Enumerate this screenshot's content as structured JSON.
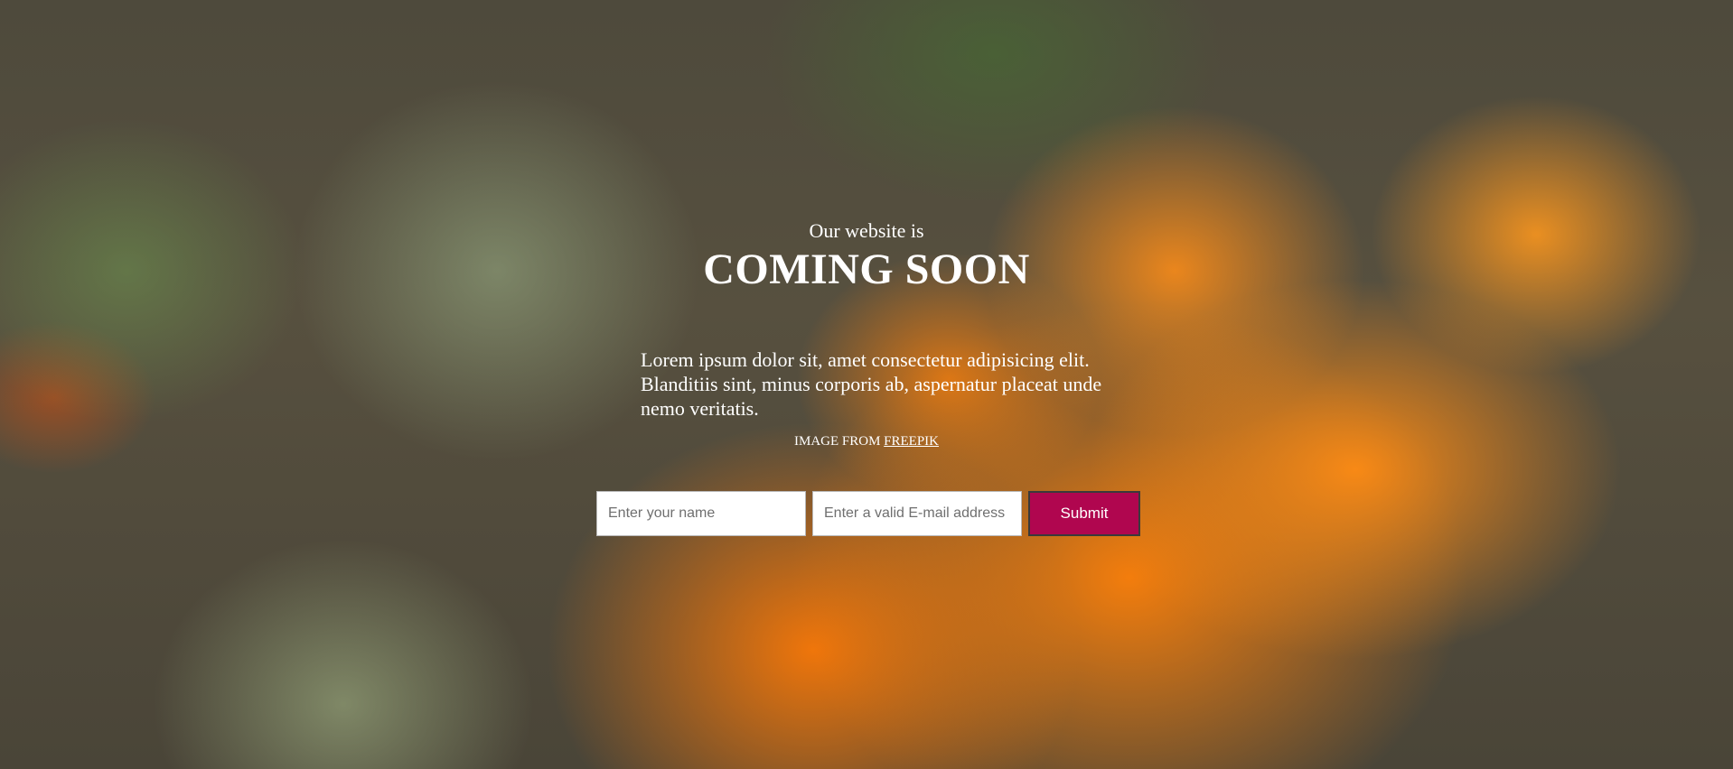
{
  "hero": {
    "subtitle": "Our website is",
    "title": "COMING SOON",
    "description": "Lorem ipsum dolor sit, amet consectetur adipisicing elit. Blanditiis sint, minus corporis ab, aspernatur placeat unde nemo veritatis.",
    "credit_prefix": "IMAGE FROM ",
    "credit_link": "FREEPIK"
  },
  "form": {
    "name_placeholder": "Enter your name",
    "email_placeholder": "Enter a valid E-mail address",
    "submit_label": "Submit"
  },
  "colors": {
    "submit_button": "#b0064f",
    "text": "#ffffff"
  },
  "background": {
    "subject": "orange-flower-photo"
  }
}
